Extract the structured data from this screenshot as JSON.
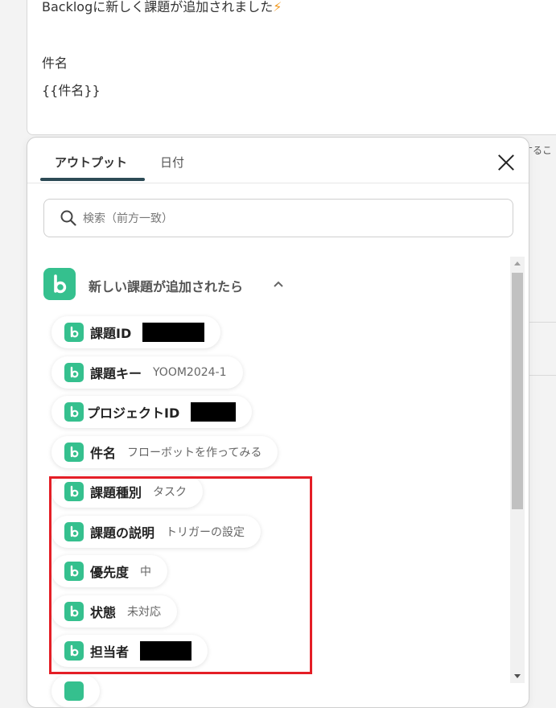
{
  "editor": {
    "line1": "Backlogに新しく課題が追加されました",
    "line1_icon": "lightning-icon",
    "line2": "件名",
    "line3": "{{件名}}"
  },
  "right_peek_text": "するこ",
  "popup": {
    "tabs": [
      {
        "label": "アウトプット",
        "active": true
      },
      {
        "label": "日付",
        "active": false
      }
    ],
    "search": {
      "placeholder": "検索（前方一致）",
      "value": ""
    },
    "section": {
      "title": "新しい課題が追加されたら",
      "expanded": true
    },
    "items": [
      {
        "label": "課題ID",
        "value": "",
        "redacted": true
      },
      {
        "label": "課題キー",
        "value": "YOOM2024-1",
        "redacted": false
      },
      {
        "label": "プロジェクトID",
        "value": "",
        "redacted": true
      },
      {
        "label": "件名",
        "value": "フローボットを作ってみる",
        "redacted": false
      },
      {
        "label": "課題種別",
        "value": "タスク",
        "redacted": false
      },
      {
        "label": "課題の説明",
        "value": "トリガーの設定",
        "redacted": false
      },
      {
        "label": "優先度",
        "value": "中",
        "redacted": false
      },
      {
        "label": "状態",
        "value": "未対応",
        "redacted": false
      },
      {
        "label": "担当者",
        "value": "",
        "redacted": true
      }
    ]
  },
  "colors": {
    "brand_green": "#35c08e",
    "highlight_red": "#e41e26",
    "tab_underline": "#2c4a55"
  }
}
